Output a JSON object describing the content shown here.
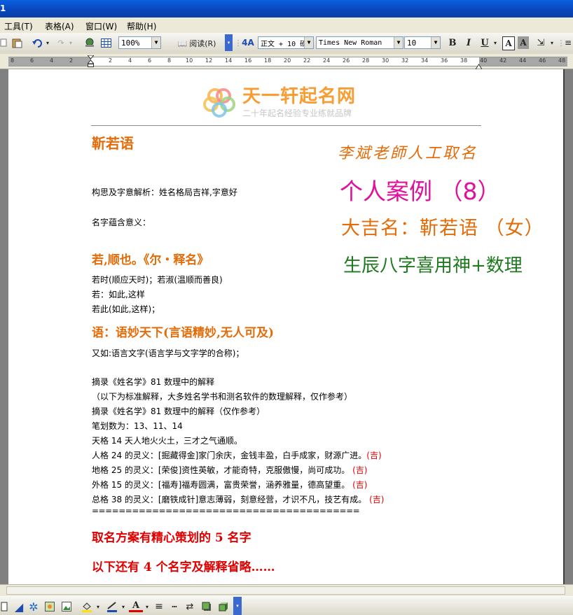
{
  "menu": {
    "items": [
      "工具(T)",
      "表格(A)",
      "窗口(W)",
      "帮助(H)"
    ]
  },
  "toolbar": {
    "zoom": "100%",
    "read_label": "阅读(R)",
    "style": "正文 + 10 磅",
    "font": "Times New Roman",
    "size": "10",
    "bold": "B",
    "italic": "I",
    "underline": "U",
    "char_border": "A",
    "char_shade": "A"
  },
  "ruler": {
    "ticks": [
      "8",
      "6",
      "4",
      "2",
      "2",
      "4",
      "6",
      "8",
      "10",
      "12",
      "14",
      "16",
      "18",
      "20",
      "22",
      "24",
      "26",
      "28",
      "30",
      "32",
      "34",
      "36",
      "38",
      "40",
      "42",
      "44",
      "46",
      "48"
    ]
  },
  "logo": {
    "name": "天一轩起名网",
    "tagline": "二十年起名经验专业练就品牌"
  },
  "doc": {
    "name_title": "靳若语",
    "teacher": "李斌老師人工取名",
    "case": "个人案例 （8）",
    "result": "大吉名：靳若语 （女）",
    "method": "生辰八字喜用神+数理",
    "intro1": "构思及字意解析：姓名格局吉祥,字意好",
    "intro2": "名字蕴含意义：",
    "ruo_heading": "若,顺也。《尔・释名》",
    "ruo_lines": [
      "若时(顺应天时)；若淑(温顺而善良)",
      "若：如此,这样",
      "若此(如此,这样)；"
    ],
    "yu_heading": "语：语妙天下(言语精妙,无人可及)",
    "yu_line": "又如:语言文字(语言学与文字学的合称)；",
    "shuli_lines": [
      "摘录《姓名学》81 数理中的解释",
      "（以下为标准解释，大多姓名学书和测名软件的数理解释，仅作参考）",
      "摘录《姓名学》81 数理中的解释（仅作参考）",
      "笔划数为：13、11、14",
      "天格 14 天人地火火土，三才之气通顺。"
    ],
    "ge_lines": [
      {
        "text": "人格 24 的灵义：[掘藏得金]家门余庆，金钱丰盈，白手成家，财源广进。",
        "ji": "(吉)"
      },
      {
        "text": "地格 25 的灵义：[荣俊]资性英敏，才能奇特，克服傲慢，尚可成功。",
        "ji": " (吉)"
      },
      {
        "text": "外格 15 的灵义：[福寿]福寿圆满，富贵荣誉，涵养雅量，德高望重。",
        "ji": " (吉)"
      },
      {
        "text": "总格 38 的灵义：[磨铁成针]意志薄弱，刻意经营，才识不凡，技艺有成。",
        "ji": " (吉)"
      }
    ],
    "separator": "========================================",
    "plan": "取名方案有精心策划的 5 名字",
    "more": "以下还有 4 个名字及解释省略……"
  },
  "colors": {
    "accent_orange": "#e36c09",
    "magenta": "#e0119c",
    "green": "#1f7a1f",
    "red": "#e00000",
    "logo_orange": "#f7931e"
  }
}
